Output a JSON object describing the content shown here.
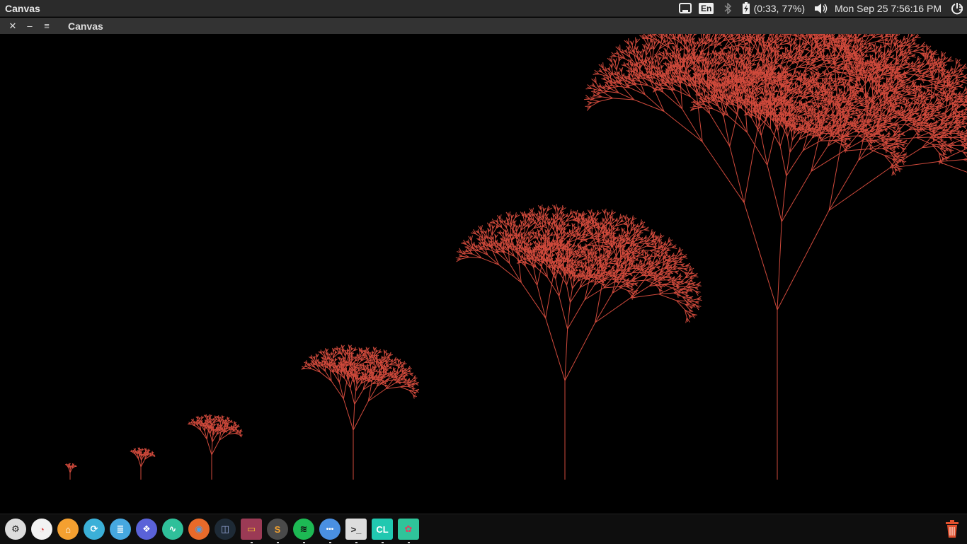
{
  "top_panel": {
    "app_title": "Canvas",
    "keyboard_layout": "En",
    "battery_text": "(0:33, 77%)",
    "datetime": "Mon Sep 25  7:56:16 PM"
  },
  "window": {
    "title": "Canvas",
    "close_glyph": "✕",
    "minimize_glyph": "–",
    "menu_glyph": "≡"
  },
  "canvas": {
    "background": "#000000",
    "stroke_color": "#d04a3c",
    "trees": [
      {
        "depth": 1
      },
      {
        "depth": 2
      },
      {
        "depth": 3
      },
      {
        "depth": 4
      },
      {
        "depth": 5
      },
      {
        "depth": 6
      }
    ]
  },
  "dock": {
    "items": [
      {
        "name": "system-settings-icon",
        "color": "#dcdcdc",
        "glyph": "⚙",
        "fg": "#222"
      },
      {
        "name": "disk-usage-icon",
        "color": "#f2f2f2",
        "glyph": "◔",
        "fg": "#e05050"
      },
      {
        "name": "software-center-icon",
        "color": "#f4a030",
        "glyph": "⌂",
        "fg": "#fff"
      },
      {
        "name": "update-manager-icon",
        "color": "#3bb0d8",
        "glyph": "⟳",
        "fg": "#fff"
      },
      {
        "name": "text-editor-icon",
        "color": "#46a8e0",
        "glyph": "≣",
        "fg": "#fff"
      },
      {
        "name": "app-icon-purple",
        "color": "#5a62d8",
        "glyph": "❖",
        "fg": "#fff"
      },
      {
        "name": "system-monitor-icon",
        "color": "#2fc09a",
        "glyph": "∿",
        "fg": "#fff"
      },
      {
        "name": "firefox-icon",
        "color": "#e86a2a",
        "glyph": "◉",
        "fg": "#4aa0e8"
      },
      {
        "name": "image-viewer-icon",
        "color": "#1e2a36",
        "glyph": "◫",
        "fg": "#9ad"
      },
      {
        "name": "files-icon",
        "color": "#9b3a55",
        "glyph": "▭",
        "fg": "#f4c030"
      },
      {
        "name": "sublime-text-icon",
        "color": "#4a4a4a",
        "glyph": "S",
        "fg": "#f0a030"
      },
      {
        "name": "spotify-icon",
        "color": "#1db954",
        "glyph": "≋",
        "fg": "#111"
      },
      {
        "name": "more-apps-icon",
        "color": "#4a90e2",
        "glyph": "•••",
        "fg": "#fff"
      },
      {
        "name": "terminal-icon",
        "color": "#dddddd",
        "glyph": ">_",
        "fg": "#222"
      },
      {
        "name": "clion-icon",
        "color": "#21c8b0",
        "glyph": "CL",
        "fg": "#fff"
      },
      {
        "name": "canvas-app-icon",
        "color": "#2fc49a",
        "glyph": "✿",
        "fg": "#e04060"
      }
    ],
    "trash": {
      "name": "trash-icon",
      "color": "#e0502e"
    }
  }
}
